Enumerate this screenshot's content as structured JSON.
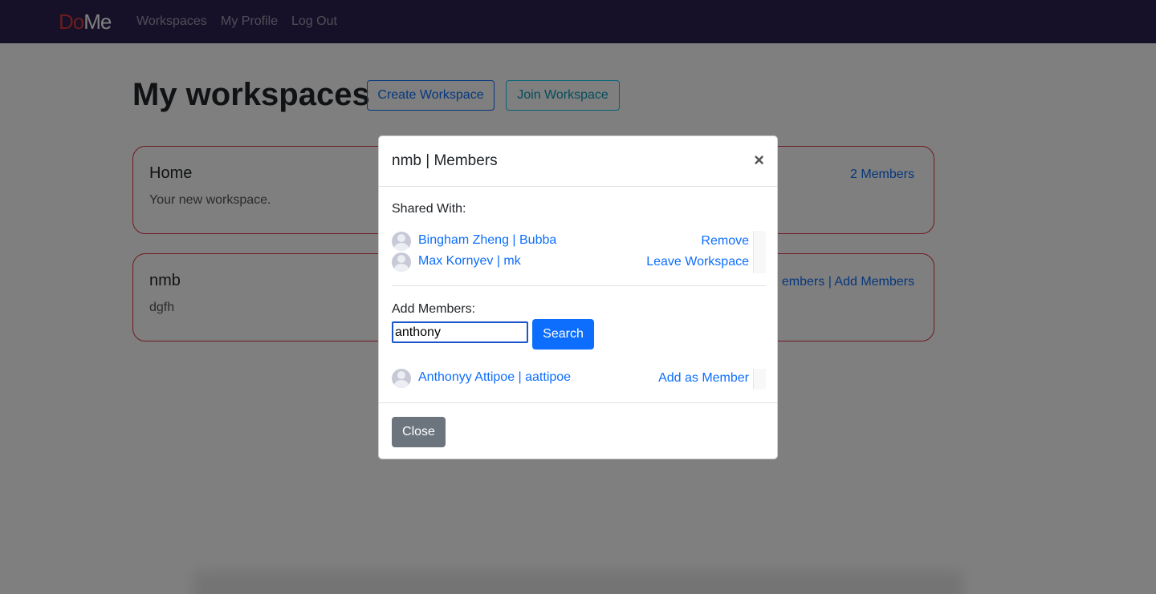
{
  "navbar": {
    "brand_part1": "Do",
    "brand_part2": "Me",
    "links": [
      "Workspaces",
      "My Profile",
      "Log Out"
    ]
  },
  "page": {
    "title": "My workspaces",
    "create_label": "Create Workspace",
    "join_label": "Join Workspace"
  },
  "cards": [
    {
      "title": "Home",
      "description": "Your new workspace.",
      "link": "2 Members"
    },
    {
      "title": "nmb",
      "description": "dgfh",
      "link": "embers | Add Members"
    }
  ],
  "modal": {
    "title": "nmb | Members",
    "close_symbol": "×",
    "shared_label": "Shared With:",
    "members": [
      {
        "name": "Bingham Zheng | Bubba",
        "action": "Remove"
      },
      {
        "name": "Max Kornyev | mk",
        "action": "Leave Workspace"
      }
    ],
    "add_label": "Add Members:",
    "search_value": "anthony",
    "search_button": "Search",
    "results": [
      {
        "name": "Anthonyy Attipoe | aattipoe",
        "action": "Add as Member"
      }
    ],
    "close_button": "Close"
  },
  "colors": {
    "navbar": "#2c2251",
    "brand_accent": "#d23a3a",
    "primary": "#0d6efd",
    "card_border": "#dc3545"
  }
}
